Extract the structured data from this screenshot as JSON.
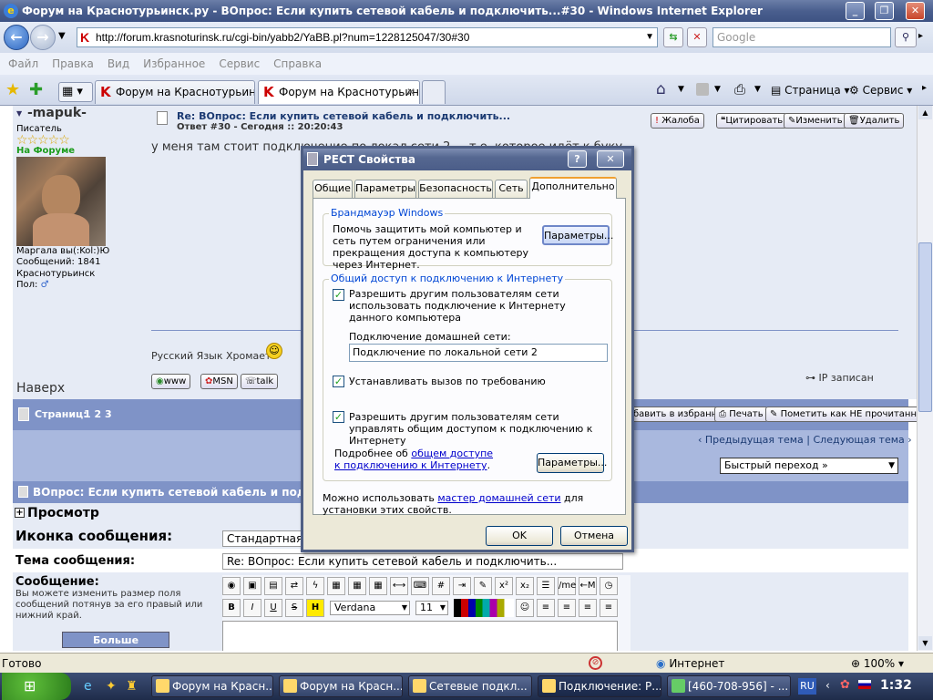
{
  "window": {
    "title": "Форум на Краснотурьинск.ру - ВОпрос: Если купить сетевой кабель и подключить...#30 - Windows Internet Explorer",
    "ie_icon": "e"
  },
  "address": {
    "url": "http://forum.krasnoturinsk.ru/cgi-bin/yabb2/YaBB.pl?num=1228125047/30#30",
    "search_placeholder": "Google"
  },
  "menu": [
    "Файл",
    "Правка",
    "Вид",
    "Избранное",
    "Сервис",
    "Справка"
  ],
  "tabs": [
    {
      "label": "Форум на Краснотурьинск...."
    },
    {
      "label": "Форум на Краснотурьин..."
    }
  ],
  "commandbar": {
    "page": "Страница",
    "service": "Сервис"
  },
  "post": {
    "author": "-mapuk-",
    "rank": "Писатель",
    "stars": "☆☆☆☆☆",
    "online": "На Форуме",
    "tagline": "Маргала вы(:Kol:)Ю",
    "messages": "Сообщений: 1841",
    "city": "Краснотурьинск",
    "gender": "Пол:",
    "title": "Re: ВОпрос: Если купить сетевой кабель и подключить...",
    "reply_info": "Ответ #30 - Сегодня :: 20:20:43",
    "text": "у меня там стоит подключение по локал сети 2 ... т.е. которое идёт к буку",
    "signature": "Русский Язык Хромает",
    "buttons": {
      "quote_complain": "Жалоба",
      "cite": "Цитировать",
      "edit": "Изменить",
      "delete": "Удалить"
    },
    "contact": [
      "www",
      "MSN",
      "talk"
    ],
    "ip": "IP записан",
    "top": "Наверх"
  },
  "pages": {
    "label": "Страниц:",
    "numbers": "1 2 3",
    "fav": "бавить в избранное",
    "print": "Печать",
    "mark": "Пометить как НЕ прочитанное"
  },
  "navigation": {
    "prev": "‹ Предыдущая тема",
    "sep": "|",
    "next": "Следующая тема ›",
    "quickjump": "Быстрый переход »"
  },
  "reply": {
    "subject_bar": "ВОпрос: Если купить сетевой кабель и подкл",
    "preview": "Просмотр",
    "icon_label": "Иконка сообщения:",
    "icon_value": "Стандартная",
    "topic_label": "Тема сообщения:",
    "topic_value": "Re: ВОпрос: Если купить сетевой кабель и подключить...",
    "message_label": "Сообщение:",
    "message_hint": "Вы можете изменить размер поля сообщений потянув за его правый или нижний край.",
    "more_smileys": "Больше смайликов",
    "font": "Verdana",
    "size": "11"
  },
  "dialog": {
    "title": "РЕСТ Свойства",
    "tabs": [
      "Общие",
      "Параметры",
      "Безопасность",
      "Сеть",
      "Дополнительно"
    ],
    "firewall": {
      "title": "Брандмауэр Windows",
      "text": "Помочь защитить мой компьютер и сеть путем ограничения или прекращения доступа к компьютеру через Интернет.",
      "button": "Параметры..."
    },
    "ics": {
      "title": "Общий доступ к подключению к Интернету",
      "allow": "Разрешить другим пользователям сети использовать подключение к Интернету данного компьютера",
      "home_label": "Подключение домашней сети:",
      "home_value": "Подключение по локальной сети 2",
      "dial": "Устанавливать вызов по требованию",
      "control": "Разрешить другим пользователям сети управлять общим доступом к подключению к Интернету",
      "more_prefix": "Подробнее об",
      "more_link": "общем доступе к подключению к Интернету",
      "more_suffix": ".",
      "button": "Параметры..."
    },
    "wizard_prefix": "Можно использовать",
    "wizard_link": "мастер домашней сети",
    "wizard_suffix": "для установки этих свойств.",
    "ok": "OK",
    "cancel": "Отмена"
  },
  "status": {
    "ready": "Готово",
    "zone": "Интернет",
    "zoom": "100%"
  },
  "taskbar": {
    "items": [
      "Форум на Красн...",
      "Форум на Красн...",
      "Сетевые подкл...",
      "Подключение: Р...",
      "[460-708-956] - ..."
    ],
    "lang": "RU",
    "clock": "1:32"
  }
}
